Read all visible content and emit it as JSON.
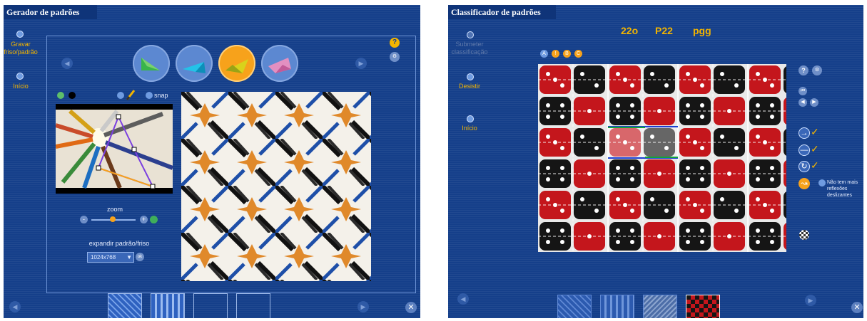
{
  "left": {
    "title": "Gerador de padrões",
    "nav": [
      {
        "label": "Gravar friso/padrão"
      },
      {
        "label": "Início"
      }
    ],
    "toolbar": {
      "snap_label": "snap"
    },
    "zoom_label": "zoom",
    "expand_label": "expandir padrão/friso",
    "resolution": {
      "selected": "1024x768",
      "ok_label": "ok"
    },
    "icons": [
      "help-icon",
      "settings-icon",
      "prev-icon",
      "next-icon",
      "close-icon",
      "pencil-icon"
    ],
    "colors": {
      "panel": "#153f8a",
      "accent": "#f7a21b",
      "label": "#f2b400"
    }
  },
  "right": {
    "title": "Classificador de padrões",
    "notation": [
      "22o",
      "P22",
      "pgg"
    ],
    "nav": [
      {
        "label": "Submeter classificação"
      },
      {
        "label": "Desistir"
      },
      {
        "label": "Início"
      }
    ],
    "symmetry_badges": [
      "A",
      "!",
      "B",
      "C"
    ],
    "no_more_label": "Não tem mais reflexões deslizantes",
    "tools": [
      "translation-icon",
      "reflection-icon",
      "rotation-icon",
      "glide-reflection-icon",
      "grid-icon"
    ]
  }
}
